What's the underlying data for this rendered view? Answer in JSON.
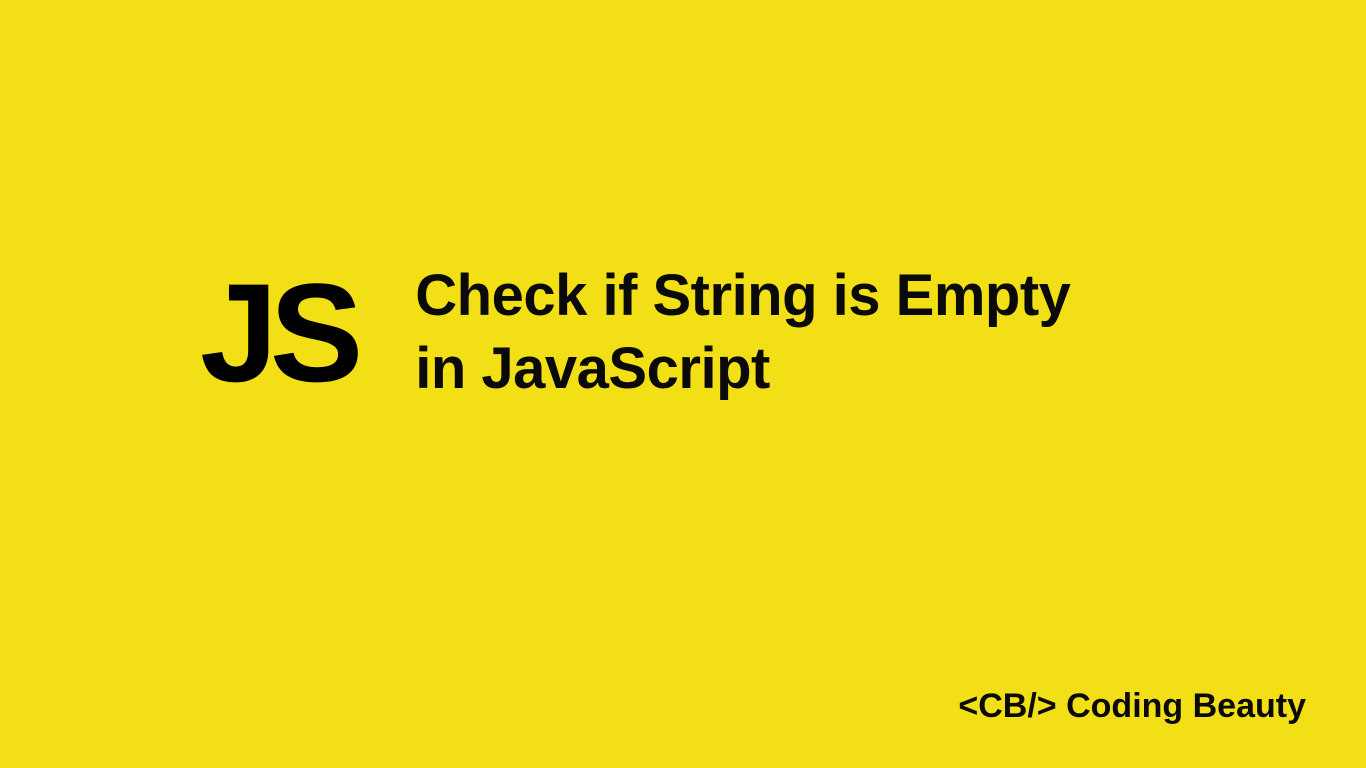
{
  "logo": {
    "text": "JS"
  },
  "headline": {
    "line1": "Check if String is Empty",
    "line2": "in JavaScript"
  },
  "brand": {
    "text": "<CB/> Coding Beauty"
  },
  "colors": {
    "background": "#f2df16",
    "text": "#0a0a0a"
  }
}
